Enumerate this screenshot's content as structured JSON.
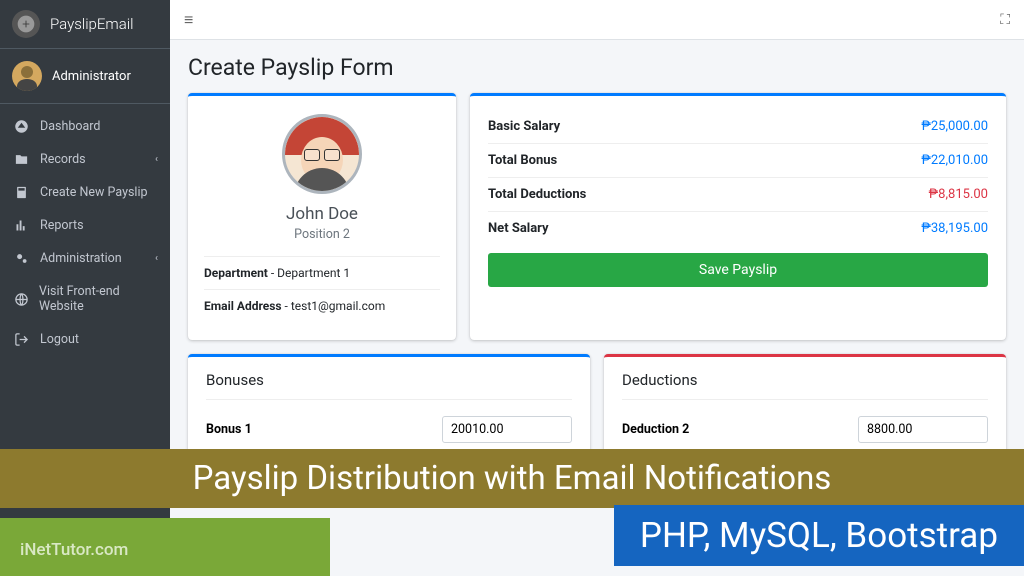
{
  "brand": {
    "name": "PayslipEmail"
  },
  "user": {
    "name": "Administrator"
  },
  "sidebar": {
    "items": [
      {
        "label": "Dashboard",
        "icon": "dashboard"
      },
      {
        "label": "Records",
        "icon": "folder",
        "chevron": true
      },
      {
        "label": "Create New Payslip",
        "icon": "calculator"
      },
      {
        "label": "Reports",
        "icon": "chart"
      },
      {
        "label": "Administration",
        "icon": "cogs",
        "chevron": true
      },
      {
        "label": "Visit Front-end Website",
        "icon": "globe"
      },
      {
        "label": "Logout",
        "icon": "logout"
      }
    ]
  },
  "page": {
    "title": "Create Payslip Form"
  },
  "profile": {
    "name": "John Doe",
    "position": "Position 2",
    "dept_label": "Department",
    "dept_value": "Department 1",
    "email_label": "Email Address",
    "email_value": "test1@gmail.com"
  },
  "summary": {
    "rows": [
      {
        "label": "Basic Salary",
        "value": "₱25,000.00",
        "neg": false
      },
      {
        "label": "Total Bonus",
        "value": "₱22,010.00",
        "neg": false
      },
      {
        "label": "Total Deductions",
        "value": "₱8,815.00",
        "neg": true
      },
      {
        "label": "Net Salary",
        "value": "₱38,195.00",
        "neg": false
      }
    ],
    "save_label": "Save Payslip"
  },
  "bonuses": {
    "title": "Bonuses",
    "row_label": "Bonus 1",
    "row_value": "20010.00"
  },
  "deductions": {
    "title": "Deductions",
    "row_label": "Deduction 2",
    "row_value": "8800.00"
  },
  "overlay": {
    "banner": "Payslip Distribution with Email Notifications",
    "sub": "PHP, MySQL, Bootstrap",
    "watermark": "iNetTutor.com"
  }
}
